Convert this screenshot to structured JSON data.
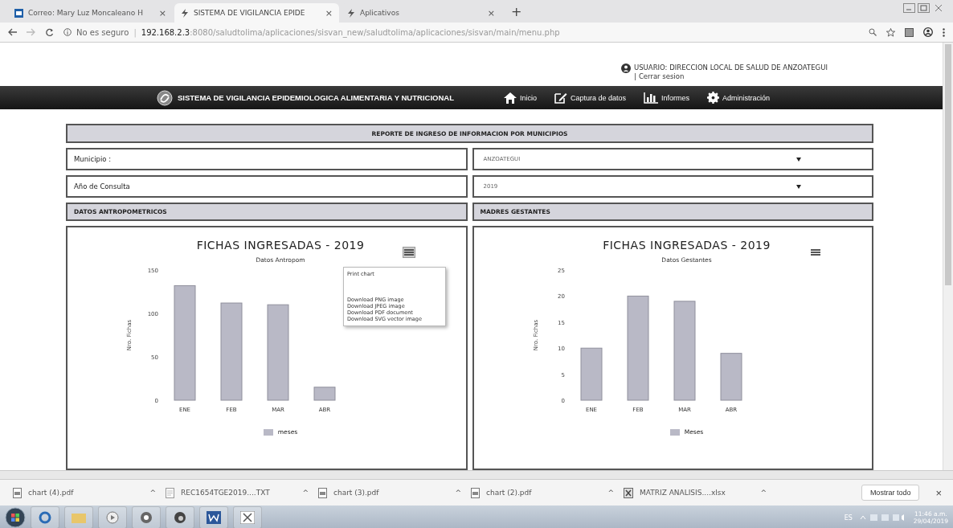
{
  "browser": {
    "tabs": [
      {
        "label": "Correo: Mary Luz Moncaleano H",
        "selected": false
      },
      {
        "label": "SISTEMA DE VIGILANCIA EPIDE",
        "selected": true
      },
      {
        "label": "Aplicativos",
        "selected": false
      }
    ],
    "tab_close": "×",
    "new_tab": "+",
    "address": {
      "security": "No es seguro",
      "separator": "|",
      "host": "192.168.2.3",
      "path": ":8080/saludtolima/aplicaciones/sisvan_new/saludtolima/aplicaciones/sisvan/main/menu.php"
    }
  },
  "user": {
    "label": "USUARIO: DIRECCION LOCAL DE SALUD DE ANZOATEGUI",
    "separator": "|",
    "logout": "Cerrar sesion"
  },
  "nav": {
    "title": "SISTEMA DE VIGILANCIA EPIDEMIOLOGICA ALIMENTARIA Y NUTRICIONAL",
    "items": [
      {
        "label": "Inicio"
      },
      {
        "label": "Captura de datos"
      },
      {
        "label": "Informes"
      },
      {
        "label": "Administración"
      }
    ]
  },
  "report": {
    "title": "REPORTE DE INGRESO DE INFORMACION POR MUNICIPIOS",
    "filters": [
      {
        "label": "Municipio :",
        "value": "ANZOATEGUI"
      },
      {
        "label": "Año de Consulta",
        "value": "2019"
      }
    ],
    "panels": [
      {
        "heading": "DATOS ANTROPOMETRICOS",
        "menu_open": true,
        "subtitle": "Datos Antropom",
        "chart_data": {
          "type": "bar",
          "title": "FICHAS INGRESADAS - 2019",
          "ylabel": "Nro. Fichas",
          "categories": [
            "ENE",
            "FEB",
            "MAR",
            "ABR"
          ],
          "series": [
            {
              "name": "meses",
              "color": "#b9b9c6",
              "values": [
                132,
                112,
                110,
                15
              ]
            }
          ],
          "ylim": [
            0,
            150
          ],
          "yticks": [
            0,
            50,
            100,
            150
          ]
        }
      },
      {
        "heading": "MADRES GESTANTES",
        "menu_open": false,
        "subtitle": "Datos Gestantes",
        "chart_data": {
          "type": "bar",
          "title": "FICHAS INGRESADAS - 2019",
          "ylabel": "Nro. Fichas",
          "categories": [
            "ENE",
            "FEB",
            "MAR",
            "ABR"
          ],
          "series": [
            {
              "name": "Meses",
              "color": "#b9b9c6",
              "values": [
                10,
                20,
                19,
                9
              ]
            }
          ],
          "ylim": [
            0,
            25
          ],
          "yticks": [
            0,
            5,
            10,
            15,
            20,
            25
          ]
        }
      }
    ],
    "export_menu": [
      "Print chart",
      "Download PNG image",
      "Download JPEG image",
      "Download PDF document",
      "Download SVG vector image"
    ]
  },
  "downloads": {
    "items": [
      {
        "name": "chart (4).pdf",
        "kind": "pdf"
      },
      {
        "name": "REC1654TGE2019....TXT",
        "kind": "txt"
      },
      {
        "name": "chart (3).pdf",
        "kind": "pdf"
      },
      {
        "name": "chart (2).pdf",
        "kind": "pdf"
      },
      {
        "name": "MATRIZ ANALISIS....xlsx",
        "kind": "xlsx"
      }
    ],
    "caret": "^",
    "show_all": "Mostrar todo",
    "close": "×"
  },
  "taskbar": {
    "lang": "ES",
    "time": "11:46 a.m.",
    "date": "29/04/2019"
  }
}
